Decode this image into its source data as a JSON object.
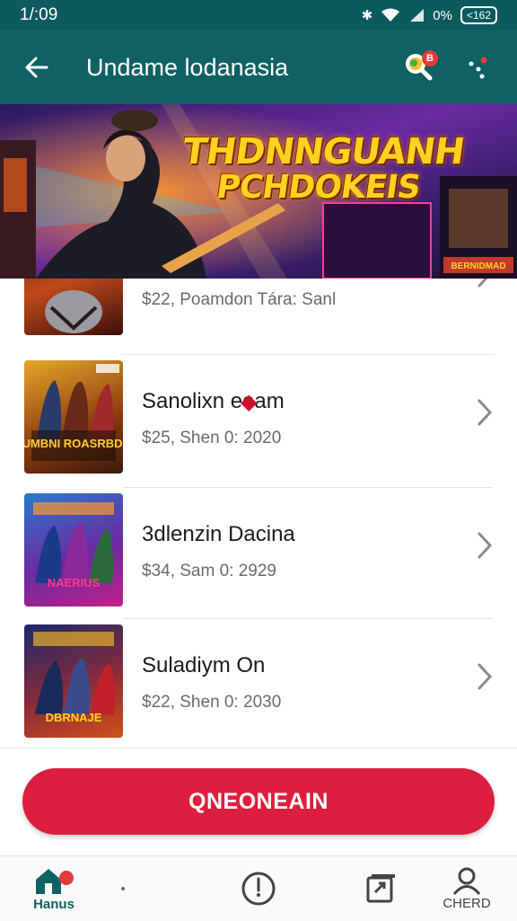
{
  "status_bar": {
    "time": "1/:09",
    "battery": "<162",
    "signal_text": "0%"
  },
  "app_bar": {
    "title": "Undame lodanasia",
    "notification_badge": "B"
  },
  "banner": {
    "title_line1": "THDNNGUANH",
    "title_line2": "PCHDOKEIS",
    "sign_text": "BERNIDMAD"
  },
  "list": {
    "items": [
      {
        "title": "",
        "subtitle": "$22, Poamdon Tára: Sanl"
      },
      {
        "title": "Sanolixn  eeam",
        "subtitle": "$25, Shen 0: 2020"
      },
      {
        "title": "3dlenzin Dacina",
        "subtitle": "$34, Sam 0: 2929"
      },
      {
        "title": "Suladiym  On",
        "subtitle": "$22, Shen 0: 2030"
      }
    ],
    "thumb_texts": [
      "",
      "DUMBNI ROASRBDIS",
      "NAERIUS",
      "DBRNAJE"
    ]
  },
  "cta": {
    "label": "QNEONEAIN"
  },
  "bottom_nav": {
    "items": [
      {
        "label": "Hanus"
      },
      {
        "label": ""
      },
      {
        "label": ""
      },
      {
        "label": "CHERD"
      }
    ]
  },
  "colors": {
    "app_bar": "#0f6164",
    "status_bar": "#0d5a5e",
    "cta": "#dc1f3e"
  }
}
